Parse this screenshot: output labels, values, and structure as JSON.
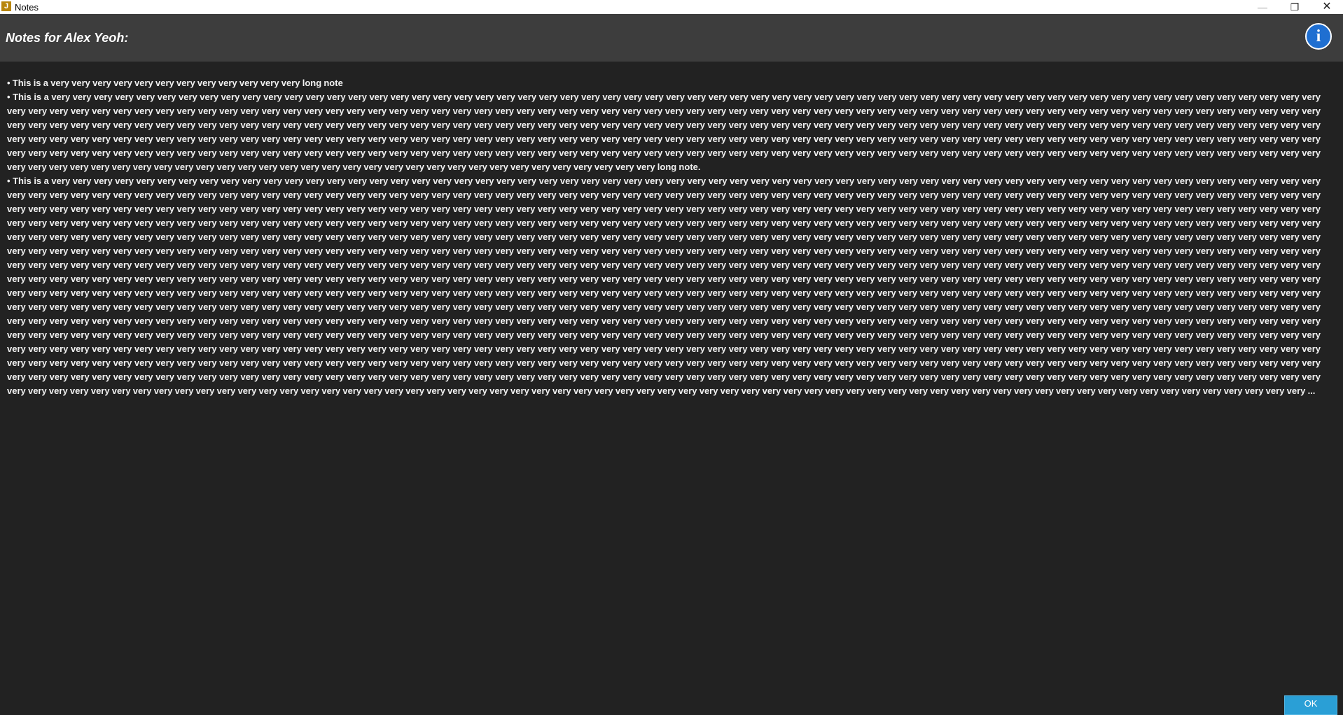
{
  "window": {
    "title": "Notes",
    "minimize_glyph": "—",
    "maximize_glyph": "❐",
    "close_glyph": "✕",
    "app_icon_glyph": "J"
  },
  "header": {
    "title": "Notes for Alex Yeoh:",
    "info_glyph": "i"
  },
  "notes": {
    "items": [
      {
        "text": "• This is a very very very very very very very very very very very very long note"
      },
      {
        "text": "• This is a very very very very very very very very very very very very very very very very very very very very very very very very very very very very very very very very very very very very very very very very very very very very very very very very very very very very very very very very very very very very very very very very very very very very very very very very very very very very very very very very very very very very very very very very very very very very very very very very very very very very very very very very very very very very very very very very very very very very very very very very very very very very very very very very very very very very very very very very very very very very very very very very very very very very very very very very very very very very very very very very very very very very very very very very very very very very very very very very very very very very very very very very very very very very very very very very very very very very very very very very very very very very very very very very very very very very very very very very very very very very very very very very very very very very very very very very very very very very very very very very very very very very very very very very very very very very very very very very very very very very very very very very very very very very very very very very very very very very very very very very very very very very very very very very very very very very very very very very very very very very very very very very very very very very very very very very very very very very very very very very very very very very very very very very very very very very very very very very very very very long note."
      },
      {
        "text": "• This is a very very very very very very very very very very very very very very very very very very very very very very very very very very very very very very very very very very very very very very very very very very very very very very very very very very very very very very very very very very very very very very very very very very very very very very very very very very very very very very very very very very very very very very very very very very very very very very very very very very very very very very very very very very very very very very very very very very very very very very very very very very very very very very very very very very very very very very very very very very very very very very very very very very very very very very very very very very very very very very very very very very very very very very very very very very very very very very very very very very very very very very very very very very very very very very very very very very very very very very very very very very very very very very very very very very very very very very very very very very very very very very very very very very very very very very very very very very very very very very very very very very very very very very very very very very very very very very very very very very very very very very very very very very very very very very very very very very very very very very very very very very very very very very very very very very very very very very very very very very very very very very very very very very very very very very very very very very very very very very very very very very very very very very very very very very very very very very very very very very very very very very very very very very very very very very very very very very very very very very very very very very very very very very very very very very very very very very very very very very very very very very very very very very very very very very very very very very very very very very very very very very very very very very very very very very very very very very very very very very very very very very very very very very very very very very very very very very very very very very very very very very very very very very very very very very very very very very very very very very very very very very very very very very very very very very very very very very very very very very very very very very very very very very very very very very very very very very very very very very very very very very very very very very very very very very very very very very very very very very very very very very very very very very very very very very very very very very very very very very very very very very very very very very very very very very very very very very very very very very very very very very very very very very very very very very very very very very very very very very very very very very very very very very very very very very very very very very very very very very very very very very very very very very very very very very very very very very very very very very very very very very very very very very very very very very very very very very very very very very very very very very very very very very very very very very very very very very very very very very very very very very very very very very very very very very very very very very very very very very very very very very very very very very very very very very very very very very very very very very very very very very very very very very very very very very very very very very very very very very very very very very very very very very very very very very very very very very very very very very very very very very very very very very very very very very very very very very very very very very very very very very very very very very very very very very very very very very very very very very very very very very very very very very very very very very very very very very very very very very very very very very very very very very very very very very very very very very very very very very very very very very very very very very very very very very very very very very very very very very very very very very very very very very very very very very very very very very very very very very very very very very very very very very very very very very very very very very very very very very very very very very very very very very very very very very very very very very very very very very very very very very very very very very very very very very very very very very very very very very very very very very very very very very very very very very very very very very very very very very very very very very very very very very very very very very very very very very very very very very very very very very very very very very very very very very very very very very very very very very very very very very very very very very very very very very ..."
      }
    ]
  },
  "footer": {
    "ok_label": "OK"
  }
}
